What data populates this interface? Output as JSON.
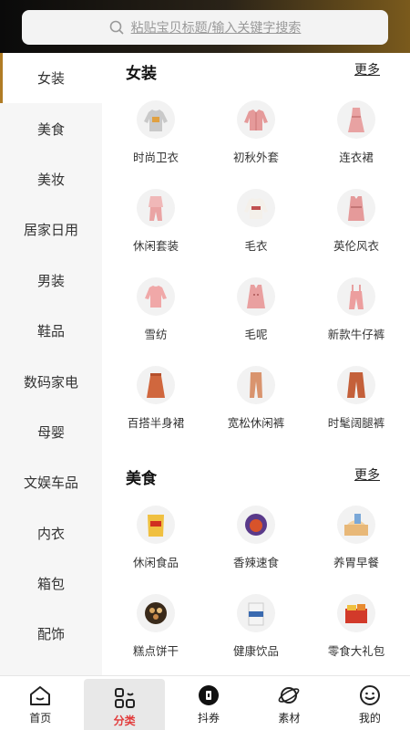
{
  "search": {
    "placeholder": "粘贴宝贝标题/输入关键字搜索"
  },
  "sidebar": {
    "items": [
      {
        "label": "女装",
        "active": true
      },
      {
        "label": "美食"
      },
      {
        "label": "美妆"
      },
      {
        "label": "居家日用"
      },
      {
        "label": "男装"
      },
      {
        "label": "鞋品"
      },
      {
        "label": "数码家电"
      },
      {
        "label": "母婴"
      },
      {
        "label": "文娱车品"
      },
      {
        "label": "内衣"
      },
      {
        "label": "箱包"
      },
      {
        "label": "配饰"
      }
    ]
  },
  "sections": [
    {
      "title": "女装",
      "more": "更多",
      "items": [
        {
          "label": "时尚卫衣",
          "icon": "hoodie-icon"
        },
        {
          "label": "初秋外套",
          "icon": "jacket-icon"
        },
        {
          "label": "连衣裙",
          "icon": "dress-icon"
        },
        {
          "label": "休闲套装",
          "icon": "casual-set-icon"
        },
        {
          "label": "毛衣",
          "icon": "sweater-icon"
        },
        {
          "label": "英伦风衣",
          "icon": "trench-coat-icon"
        },
        {
          "label": "雪纺",
          "icon": "chiffon-top-icon"
        },
        {
          "label": "毛呢",
          "icon": "wool-coat-icon"
        },
        {
          "label": "新款牛仔裤",
          "icon": "overalls-icon"
        },
        {
          "label": "百搭半身裙",
          "icon": "skirt-icon"
        },
        {
          "label": "宽松休闲裤",
          "icon": "loose-pants-icon"
        },
        {
          "label": "时髦阔腿裤",
          "icon": "wide-leg-pants-icon"
        }
      ]
    },
    {
      "title": "美食",
      "more": "更多",
      "items": [
        {
          "label": "休闲食品",
          "icon": "snack-bag-icon"
        },
        {
          "label": "香辣速食",
          "icon": "spicy-food-icon"
        },
        {
          "label": "养胃早餐",
          "icon": "bread-icon"
        },
        {
          "label": "糕点饼干",
          "icon": "cookie-box-icon"
        },
        {
          "label": "健康饮品",
          "icon": "drink-box-icon"
        },
        {
          "label": "零食大礼包",
          "icon": "gift-pack-icon"
        }
      ]
    }
  ],
  "tabbar": {
    "items": [
      {
        "label": "首页",
        "icon": "home-icon"
      },
      {
        "label": "分类",
        "icon": "category-icon",
        "active": true
      },
      {
        "label": "抖券",
        "icon": "coupon-icon"
      },
      {
        "label": "素材",
        "icon": "planet-icon"
      },
      {
        "label": "我的",
        "icon": "smile-icon"
      }
    ]
  },
  "colors": {
    "accent": "#b07c25",
    "active_tab": "#e23b3b",
    "sidebar_bg": "#f6f6f6"
  }
}
